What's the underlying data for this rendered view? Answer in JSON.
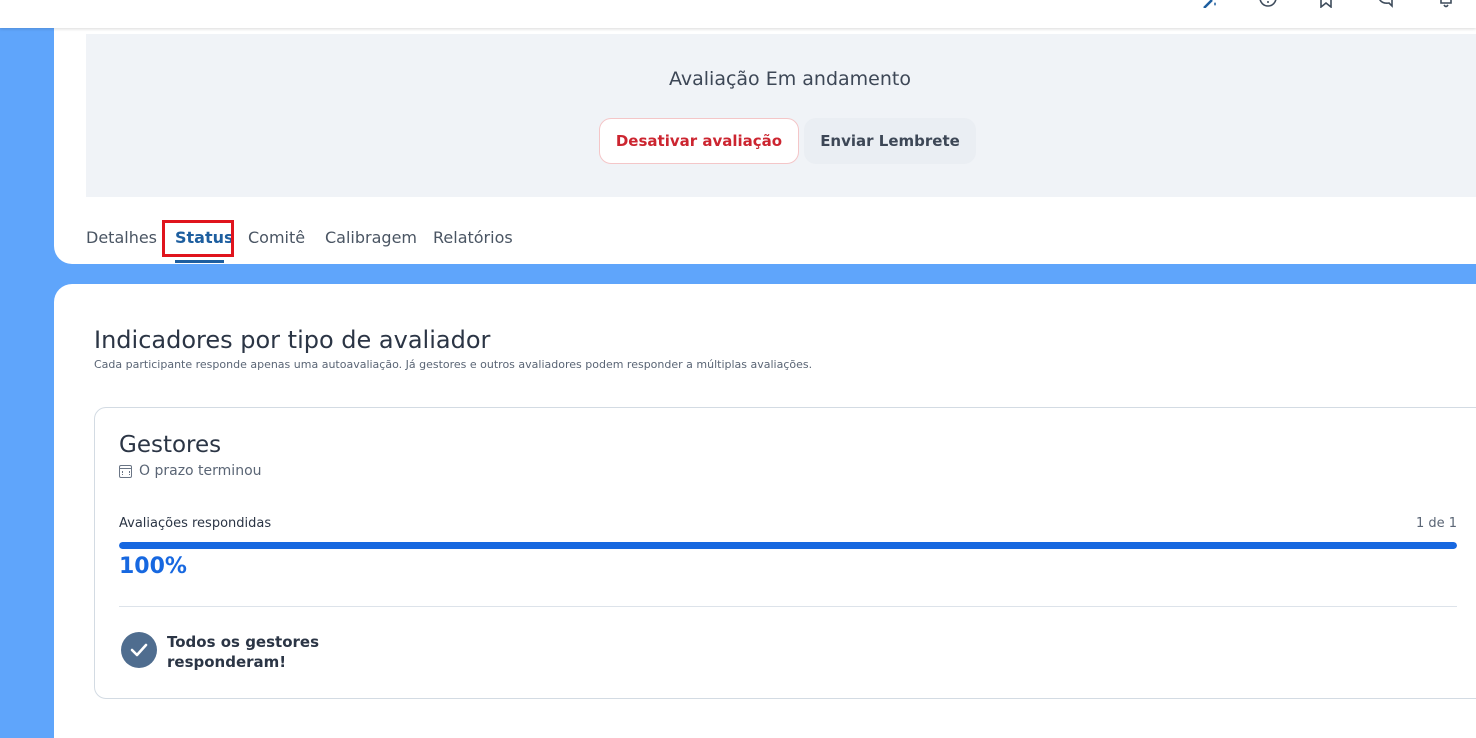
{
  "status": {
    "banner_title": "Avaliação Em andamento",
    "deactivate_label": "Desativar avaliação",
    "remind_label": "Enviar Lembrete"
  },
  "tabs": [
    {
      "label": "Detalhes"
    },
    {
      "label": "Status"
    },
    {
      "label": "Comitê"
    },
    {
      "label": "Calibragem"
    },
    {
      "label": "Relatórios"
    }
  ],
  "active_tab": "Status",
  "topbar_icons": [
    "magic-wand-icon",
    "help-icon",
    "bookmark-icon",
    "chat-icon",
    "bell-icon"
  ],
  "indicators": {
    "title": "Indicadores por tipo de avaliador",
    "subtitle": "Cada participante responde apenas uma autoavaliação. Já gestores e outros avaliadores podem responder a múltiplas avaliações."
  },
  "managers_card": {
    "title": "Gestores",
    "deadline": "O prazo terminou",
    "progress_label": "Avaliações respondidas",
    "progress_count": "1 de 1",
    "progress_fraction": 1.0,
    "progress_percent": "100%",
    "completion_message": "Todos os gestores responderam!"
  },
  "colors": {
    "background": "#5fa5fb",
    "accent": "#1768e0",
    "danger": "#cc2530",
    "active_tab": "#1d5e9f",
    "check_circle": "#4f6d8f"
  }
}
